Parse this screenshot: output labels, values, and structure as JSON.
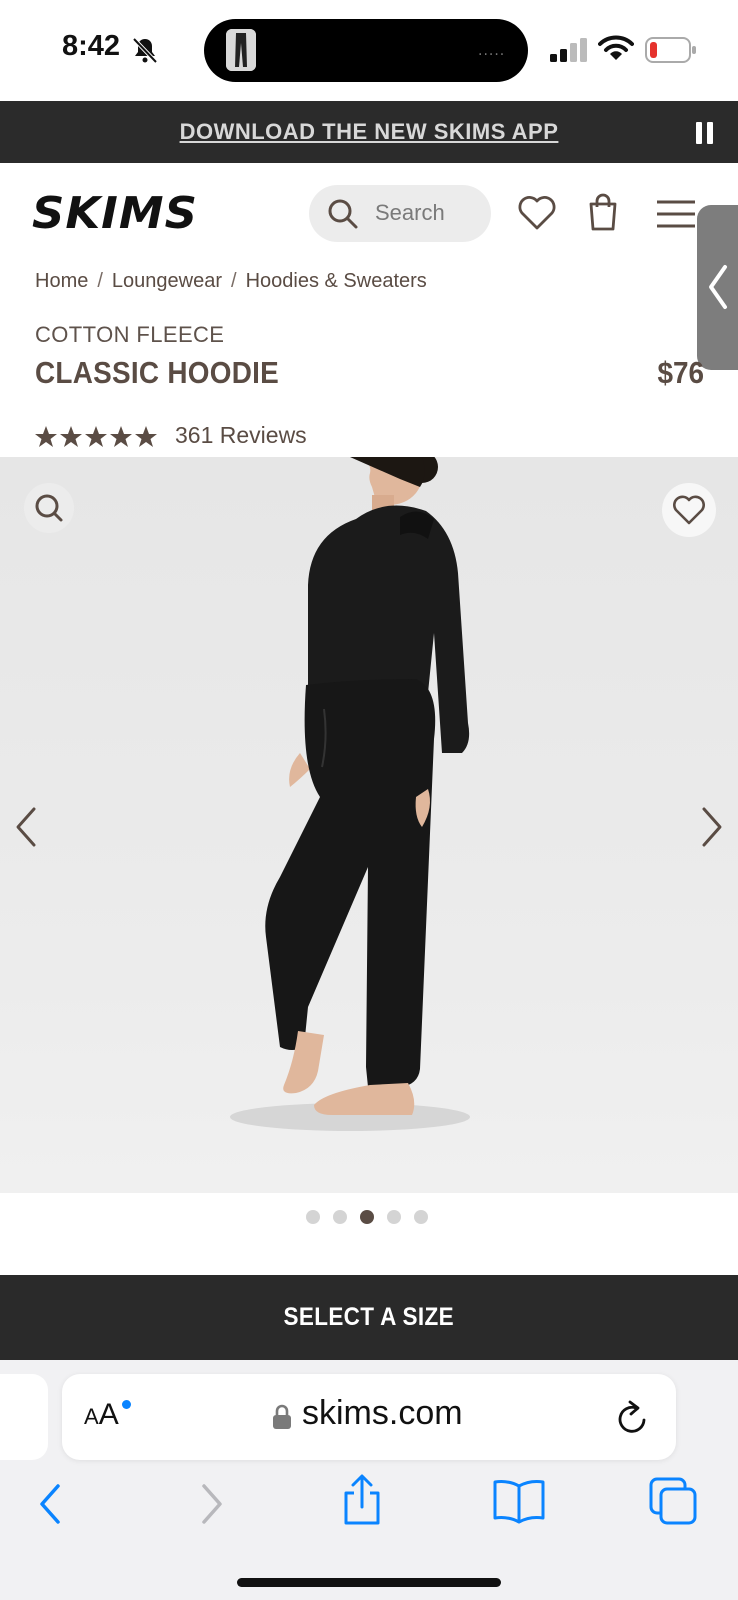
{
  "status_bar": {
    "time": "8:42"
  },
  "promo_banner": {
    "text": "DOWNLOAD THE NEW SKIMS APP"
  },
  "header": {
    "logo_text": "SKIMS",
    "search_placeholder": "Search"
  },
  "breadcrumb": [
    "Home",
    "Loungewear",
    "Hoodies & Sweaters"
  ],
  "product": {
    "collection": "COTTON FLEECE",
    "name": "CLASSIC HOODIE",
    "price": "$76",
    "rating": 5,
    "reviews_text": "361 Reviews"
  },
  "gallery": {
    "image_count": 5,
    "active_index": 2
  },
  "cta": {
    "select_size_label": "SELECT A SIZE"
  },
  "browser": {
    "text_size_label": "AA",
    "url": "skims.com"
  },
  "colors": {
    "brand_text": "#5a4c44",
    "banner_bg": "#2b2b2b",
    "cta_bg": "#2a2a2a",
    "ios_blue": "#0a84ff"
  },
  "icons": [
    "bell-slash-icon",
    "signal-icon",
    "wifi-icon",
    "battery-icon",
    "pause-icon",
    "search-icon",
    "heart-icon",
    "bag-icon",
    "menu-icon",
    "chevron-left-icon",
    "chevron-right-icon",
    "star-icon",
    "lock-icon",
    "reload-icon",
    "share-icon",
    "book-icon",
    "tabs-icon"
  ]
}
